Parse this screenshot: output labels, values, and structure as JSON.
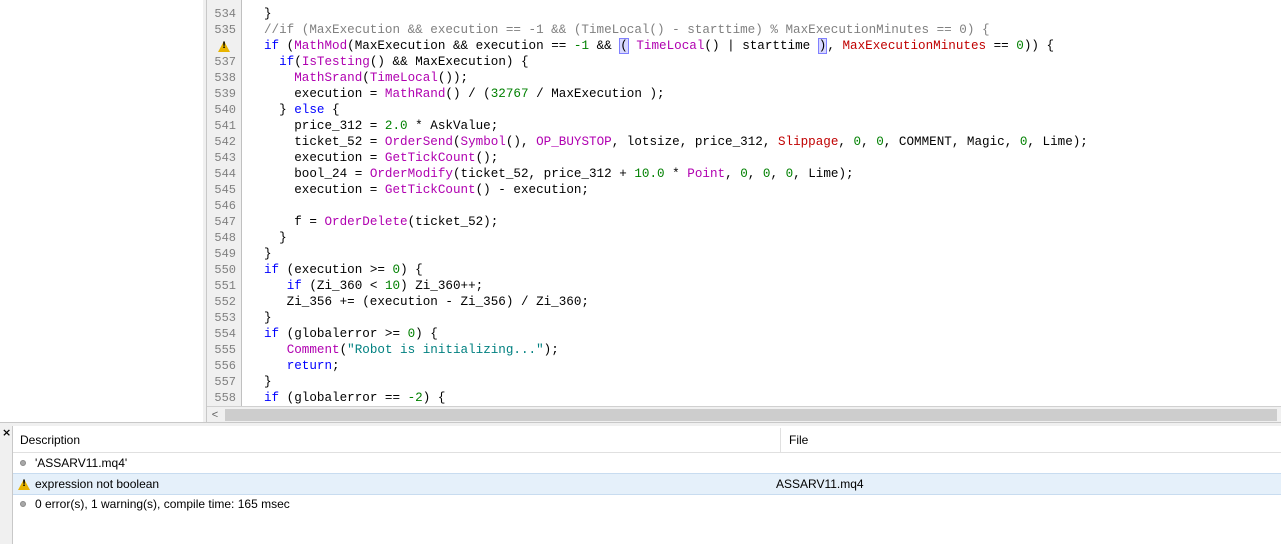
{
  "editor": {
    "lines": [
      {
        "ln": "534",
        "html": "<span>}</span>"
      },
      {
        "ln": "535",
        "html": "<span class=\"cm\">//if (MaxExecution &amp;&amp; execution == -1 &amp;&amp; (TimeLocal() - starttime) % MaxExecutionMinutes == 0) {</span>"
      },
      {
        "ln": "",
        "warning": true,
        "html": "<span class=\"k\">if</span> (<span class=\"f\">MathMod</span>(MaxExecution &amp;&amp; execution == <span class=\"n\">-1</span> &amp;&amp; <span class=\"hl\">(</span> <span class=\"f\">TimeLocal</span>() | starttime <span class=\"hl\">)</span>, <span class=\"p\">MaxExecutionMinutes</span> == <span class=\"n\">0</span>)) {"
      },
      {
        "ln": "537",
        "html": "  <span class=\"k\">if</span>(<span class=\"f\">IsTesting</span>() &amp;&amp; MaxExecution) {"
      },
      {
        "ln": "538",
        "html": "    <span class=\"f\">MathSrand</span>(<span class=\"f\">TimeLocal</span>());"
      },
      {
        "ln": "539",
        "html": "    execution = <span class=\"f\">MathRand</span>() / (<span class=\"n\">32767</span> / MaxExecution );"
      },
      {
        "ln": "540",
        "html": "  } <span class=\"k\">else</span> {"
      },
      {
        "ln": "541",
        "html": "    price_312 = <span class=\"n\">2.0</span> * AskValue;"
      },
      {
        "ln": "542",
        "html": "    ticket_52 = <span class=\"f\">OrderSend</span>(<span class=\"f\">Symbol</span>(), <span class=\"f\">OP_BUYSTOP</span>, lotsize, price_312, <span class=\"p\">Slippage</span>, <span class=\"n\">0</span>, <span class=\"n\">0</span>, COMMENT, Magic, <span class=\"n\">0</span>, Lime);"
      },
      {
        "ln": "543",
        "html": "    execution = <span class=\"f\">GetTickCount</span>();"
      },
      {
        "ln": "544",
        "html": "    bool_24 = <span class=\"f\">OrderModify</span>(ticket_52, price_312 + <span class=\"n\">10.0</span> * <span class=\"f\">Point</span>, <span class=\"n\">0</span>, <span class=\"n\">0</span>, <span class=\"n\">0</span>, Lime);"
      },
      {
        "ln": "545",
        "html": "    execution = <span class=\"f\">GetTickCount</span>() - execution;"
      },
      {
        "ln": "546",
        "html": ""
      },
      {
        "ln": "547",
        "html": "    f = <span class=\"f\">OrderDelete</span>(ticket_52);"
      },
      {
        "ln": "548",
        "html": "  }"
      },
      {
        "ln": "549",
        "html": "}"
      },
      {
        "ln": "550",
        "html": "<span class=\"k\">if</span> (execution &gt;= <span class=\"n\">0</span>) {"
      },
      {
        "ln": "551",
        "html": "   <span class=\"k\">if</span> (Zi_360 &lt; <span class=\"n\">10</span>) Zi_360++;"
      },
      {
        "ln": "552",
        "html": "   Zi_356 += (execution - Zi_356) / Zi_360;"
      },
      {
        "ln": "553",
        "html": "}"
      },
      {
        "ln": "554",
        "html": "<span class=\"k\">if</span> (globalerror &gt;= <span class=\"n\">0</span>) {"
      },
      {
        "ln": "555",
        "html": "   <span class=\"f\">Comment</span>(<span class=\"s\">\"Robot is initializing...\"</span>);"
      },
      {
        "ln": "556",
        "html": "   <span class=\"k\">return</span>;"
      },
      {
        "ln": "557",
        "html": "}"
      },
      {
        "ln": "558",
        "html": "<span class=\"k\">if</span> (globalerror == <span class=\"n\">-2</span>) {"
      }
    ]
  },
  "toolbox": {
    "close": "×",
    "headers": {
      "description": "Description",
      "file": "File"
    },
    "rows": [
      {
        "icon": "info-dot",
        "description": "'ASSARV11.mq4'",
        "file": "",
        "selected": false
      },
      {
        "icon": "warning-icon",
        "description": "expression not boolean",
        "file": "ASSARV11.mq4",
        "selected": true
      },
      {
        "icon": "info-dot",
        "description": "0 error(s), 1 warning(s), compile time: 165 msec",
        "file": "",
        "selected": false
      }
    ]
  },
  "scroll": {
    "left_arrow": "<"
  }
}
